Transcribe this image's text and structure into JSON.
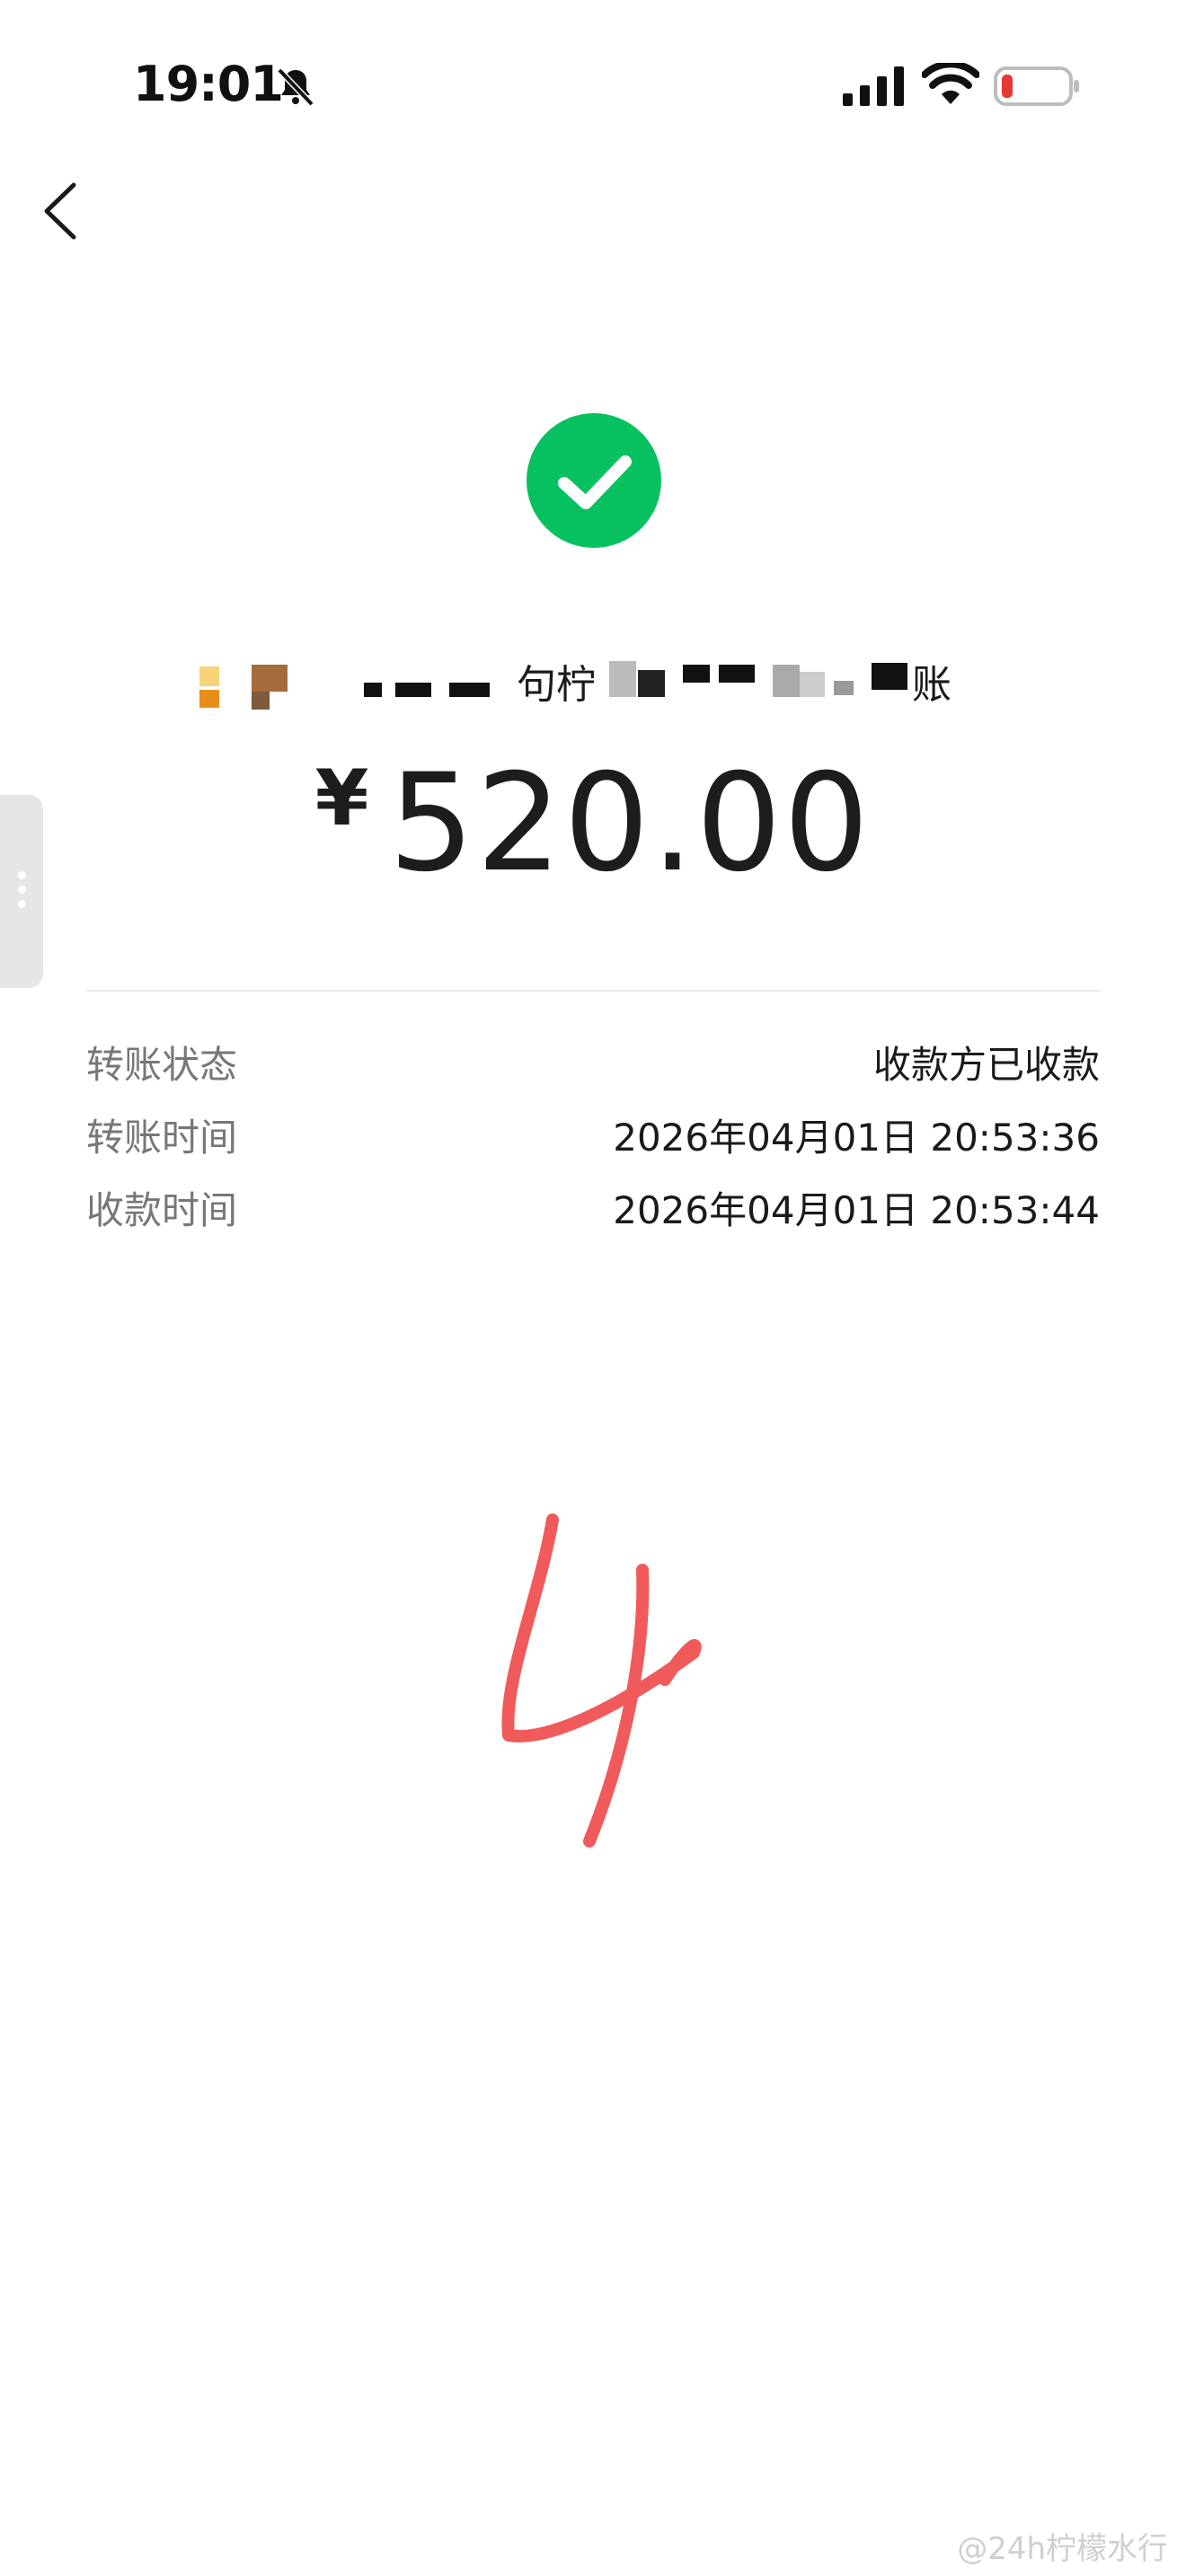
{
  "status_bar": {
    "time": "19:01",
    "battery_color": "#e53935"
  },
  "nav": {
    "back_icon": "chevron-left-icon"
  },
  "transfer": {
    "status_icon": "check-circle-icon",
    "status_icon_color": "#07c160",
    "description_visible": "句柠",
    "description_visible_2": "账",
    "currency_symbol": "¥",
    "amount": "520.00"
  },
  "details": [
    {
      "label": "转账状态",
      "value": "收款方已收款"
    },
    {
      "label": "转账时间",
      "value": "2026年04月01日 20:53:36"
    },
    {
      "label": "收款时间",
      "value": "2026年04月01日 20:53:44"
    }
  ],
  "annotation": {
    "handwritten": "4",
    "color": "#f05a5a"
  },
  "watermark": "@24h柠檬水行"
}
